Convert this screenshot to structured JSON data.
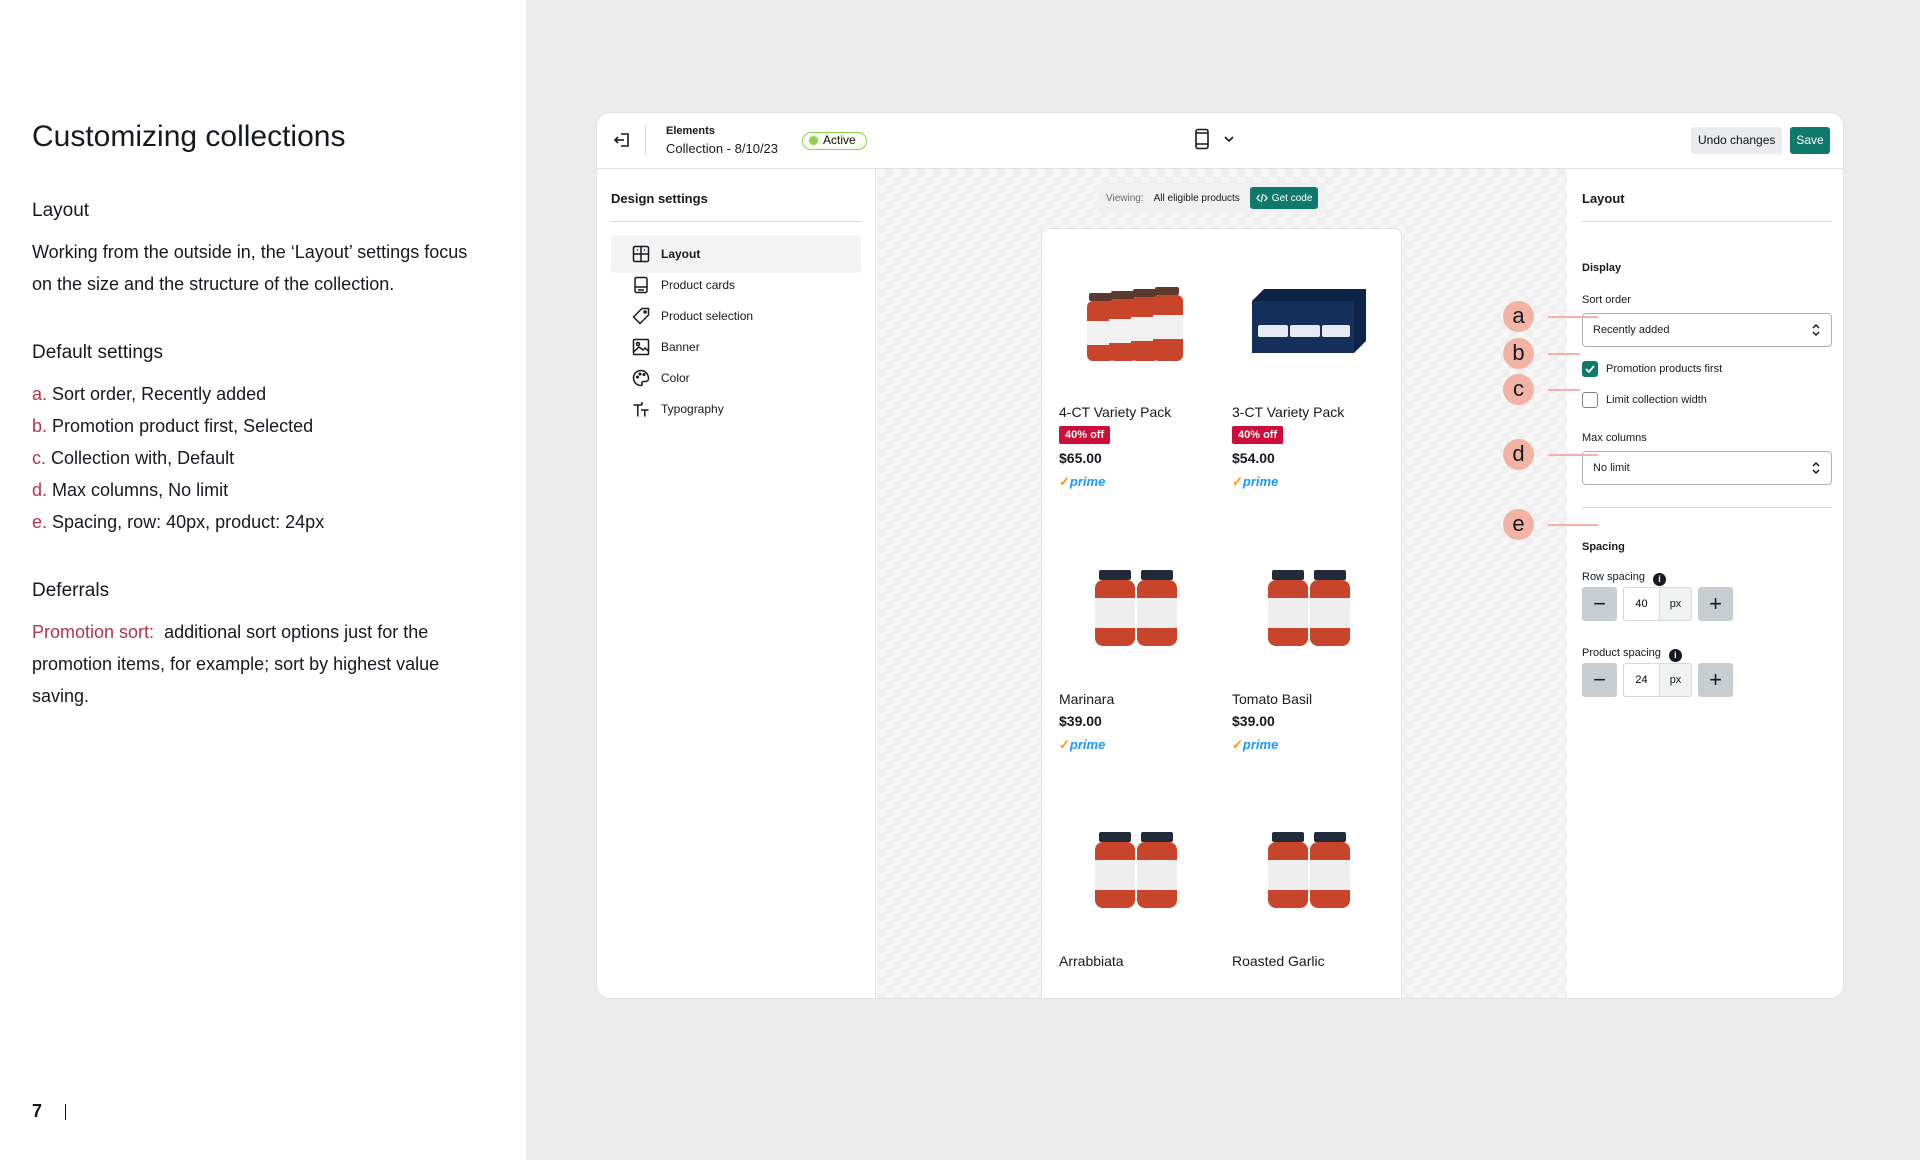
{
  "doc": {
    "title": "Customizing collections",
    "layout_heading": "Layout",
    "layout_body": "Working from the outside in, the ‘Layout’ settings focus on the size and the structure of the collection.",
    "defaults_heading": "Default settings",
    "defaults": [
      {
        "letter": "a.",
        "text": "Sort order, Recently added"
      },
      {
        "letter": "b.",
        "text": "Promotion product first, Selected"
      },
      {
        "letter": "c.",
        "text": "Collection with, Default"
      },
      {
        "letter": "d.",
        "text": "Max columns, No limit"
      },
      {
        "letter": "e.",
        "text": "Spacing, row: 40px, product: 24px"
      }
    ],
    "deferrals_heading": "Deferrals",
    "deferral_label": "Promotion sort:",
    "deferral_body": "additional sort options just for the promotion items, for example; sort by highest value saving.",
    "page_number": "7"
  },
  "app": {
    "breadcrumb_top": "Elements",
    "breadcrumb_sub": "Collection - 8/10/23",
    "status": "Active",
    "undo_label": "Undo changes",
    "save_label": "Save",
    "device_icon": "mobile-icon"
  },
  "sidebar": {
    "title": "Design settings",
    "items": [
      {
        "label": "Layout",
        "icon": "layout-icon"
      },
      {
        "label": "Product cards",
        "icon": "product-card-icon"
      },
      {
        "label": "Product selection",
        "icon": "tag-icon"
      },
      {
        "label": "Banner",
        "icon": "image-icon"
      },
      {
        "label": "Color",
        "icon": "palette-icon"
      },
      {
        "label": "Typography",
        "icon": "typography-icon"
      }
    ]
  },
  "canvas": {
    "viewing_label": "Viewing:",
    "viewing_value": "All eligible products",
    "get_code_label": "Get code",
    "products": [
      {
        "name": "4-CT Variety Pack",
        "badge": "40% off",
        "price": "$65.00",
        "prime": "prime"
      },
      {
        "name": "3-CT Variety Pack",
        "badge": "40% off",
        "price": "$54.00",
        "prime": "prime"
      },
      {
        "name": "Marinara",
        "badge": "",
        "price": "$39.00",
        "prime": "prime"
      },
      {
        "name": "Tomato Basil",
        "badge": "",
        "price": "$39.00",
        "prime": "prime"
      },
      {
        "name": "Arrabbiata",
        "badge": "",
        "price": "",
        "prime": ""
      },
      {
        "name": "Roasted Garlic",
        "badge": "",
        "price": "",
        "prime": ""
      }
    ]
  },
  "props": {
    "title": "Layout",
    "display_heading": "Display",
    "sort_label": "Sort order",
    "sort_value": "Recently added",
    "promo_first_label": "Promotion products first",
    "promo_first_checked": true,
    "limit_width_label": "Limit collection width",
    "limit_width_checked": false,
    "max_columns_label": "Max columns",
    "max_columns_value": "No limit",
    "spacing_heading": "Spacing",
    "row_spacing_label": "Row spacing",
    "row_spacing_value": "40",
    "product_spacing_label": "Product spacing",
    "product_spacing_value": "24",
    "unit": "px"
  },
  "markers": [
    "a",
    "b",
    "c",
    "d",
    "e"
  ],
  "colors": {
    "accent": "#0f7a6c",
    "annotation": "#f2b3a5",
    "doc_highlight": "#b0344f",
    "badge": "#cc0c39"
  }
}
